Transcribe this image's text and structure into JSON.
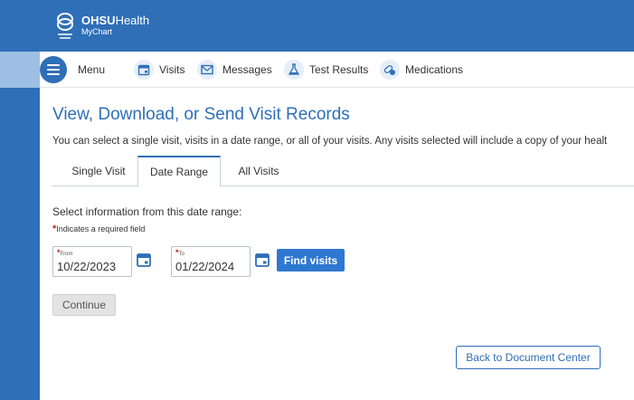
{
  "header": {
    "brand_bold": "OHSU",
    "brand_rest": "Health",
    "sub": "MyChart"
  },
  "nav": {
    "menu": "Menu",
    "items": [
      {
        "label": "Visits",
        "icon": "calendar-icon"
      },
      {
        "label": "Messages",
        "icon": "envelope-icon"
      },
      {
        "label": "Test Results",
        "icon": "flask-icon"
      },
      {
        "label": "Medications",
        "icon": "pills-icon"
      }
    ]
  },
  "page": {
    "title": "View, Download, or Send Visit Records",
    "subtitle": "You can select a single visit, visits in a date range, or all of your visits. Any visits selected will include a copy of your healt"
  },
  "tabs": [
    "Single Visit",
    "Date Range",
    "All Visits"
  ],
  "active_tab": "Date Range",
  "form": {
    "select_label": "Select information from this date range:",
    "required_star": "*",
    "required_note": "Indicates a required field",
    "from_label": "From",
    "from_value": "10/22/2023",
    "to_label": "To",
    "to_value": "01/22/2024",
    "find_button": "Find visits",
    "continue_button": "Continue"
  },
  "footer": {
    "back_button": "Back to Document Center"
  },
  "colors": {
    "brand_blue": "#2f6fb7",
    "button_blue": "#2f78d1",
    "required_red": "#b1271b"
  }
}
